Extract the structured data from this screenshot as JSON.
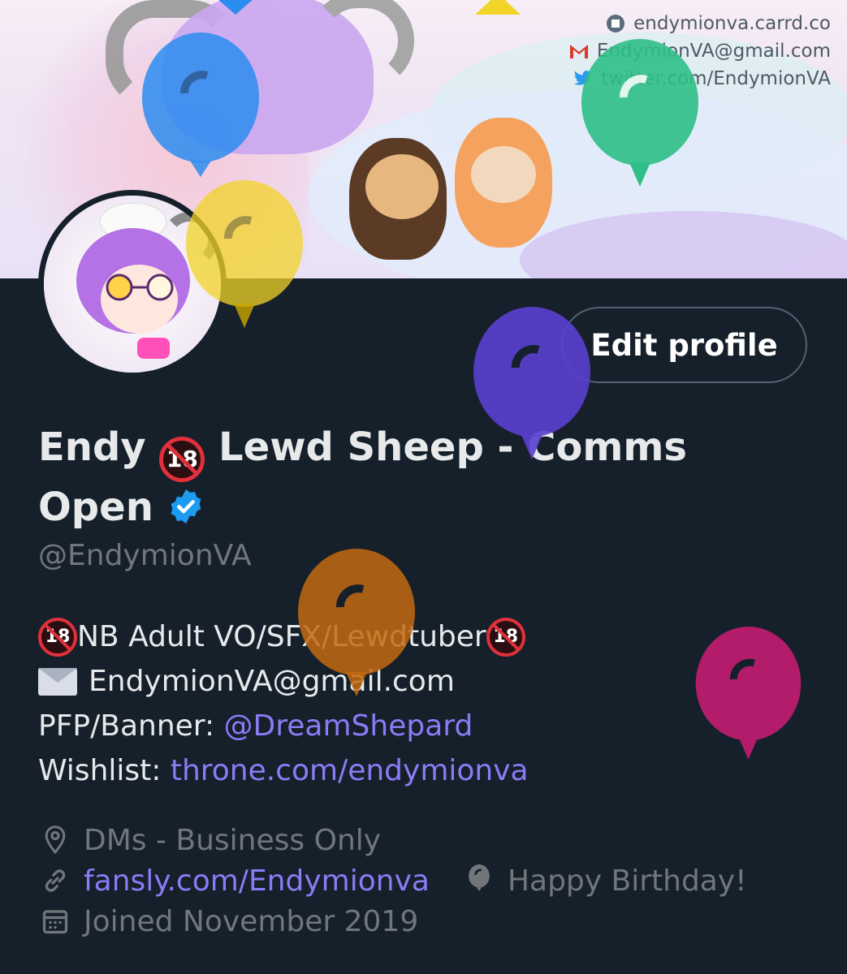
{
  "banner": {
    "contacts": [
      {
        "icon": "carrd-icon",
        "text": "endymionva.carrd.co"
      },
      {
        "icon": "gmail-icon",
        "text": "EndymionVA@gmail.com"
      },
      {
        "icon": "twitter-bird-icon",
        "text": "twitter.com/EndymionVA"
      }
    ]
  },
  "profile": {
    "edit_button": "Edit profile",
    "name_part1": "Endy",
    "name_badge": "18",
    "name_part2": "Lewd Sheep - Comms Open",
    "handle": "@EndymionVA",
    "bio": {
      "line1_badge": "18",
      "line1_text": "NB Adult VO/SFX/Lewdtuber",
      "line2_text": "EndymionVA@gmail.com",
      "line3_label": "PFP/Banner: ",
      "line3_link": "@DreamShepard",
      "line4_label": "Wishlist: ",
      "line4_link": "throne.com/endymionva"
    },
    "location": "DMs - Business Only",
    "website": "fansly.com/Endymionva",
    "birthday": "Happy Birthday!",
    "joined": "Joined November 2019"
  },
  "colors": {
    "background": "#15202b",
    "link": "#8a7cf5",
    "muted": "#71767b",
    "balloons": [
      "#2b8cf0",
      "#f2d327",
      "#2fbf86",
      "#5a3fd0",
      "#c26a10",
      "#b21c6a"
    ]
  }
}
